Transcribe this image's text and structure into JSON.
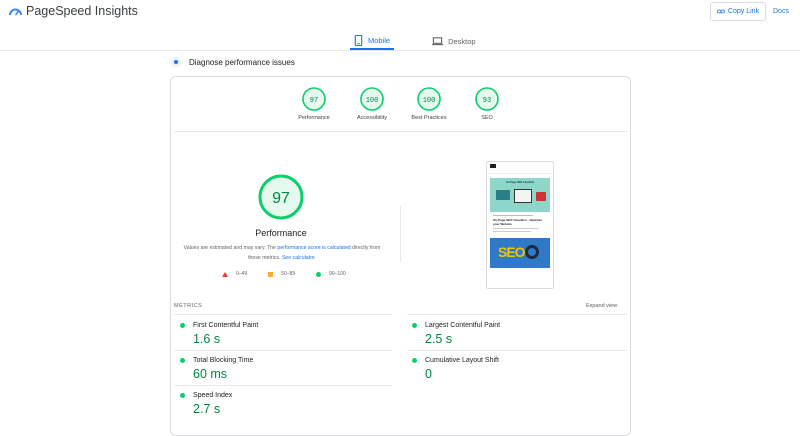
{
  "app": {
    "title": "PageSpeed Insights",
    "copy_link": "Copy Link",
    "docs": "Docs"
  },
  "tabs": [
    {
      "label": "Mobile",
      "active": true,
      "icon": "phone-icon"
    },
    {
      "label": "Desktop",
      "active": false,
      "icon": "laptop-icon"
    }
  ],
  "diagnose": {
    "label": "Diagnose performance issues"
  },
  "categories": [
    {
      "label": "Performance",
      "score": "97"
    },
    {
      "label": "Accessibility",
      "score": "100"
    },
    {
      "label": "Best Practices",
      "score": "100"
    },
    {
      "label": "SEO",
      "score": "93"
    }
  ],
  "performance": {
    "score": "97",
    "title": "Performance",
    "desc_1": "Values are estimated and may vary. The ",
    "desc_link_1": "performance score is calculated",
    "desc_2": " directly from these metrics. ",
    "desc_link_2": "See calculator."
  },
  "legend": [
    {
      "range": "0–49",
      "color": "#ff3333"
    },
    {
      "range": "50–89",
      "color": "#ffaa33"
    },
    {
      "range": "90–100",
      "color": "#0cce6b"
    }
  ],
  "screenshot": {
    "hero_title": "On-Page SEO Checklist",
    "article_title": "On-Page SEO Checklist - Optimize your Website",
    "hero_2_text": "SEO"
  },
  "metrics": {
    "label": "METRICS",
    "expand": "Expand view",
    "items": [
      {
        "name": "First Contentful Paint",
        "value": "1.6 s"
      },
      {
        "name": "Largest Contentful Paint",
        "value": "2.5 s"
      },
      {
        "name": "Total Blocking Time",
        "value": "60 ms"
      },
      {
        "name": "Cumulative Layout Shift",
        "value": "0"
      },
      {
        "name": "Speed Index",
        "value": "2.7 s"
      }
    ]
  },
  "colors": {
    "accent": "#1a73e8",
    "good": "#0cce6b",
    "good_text": "#018642"
  }
}
